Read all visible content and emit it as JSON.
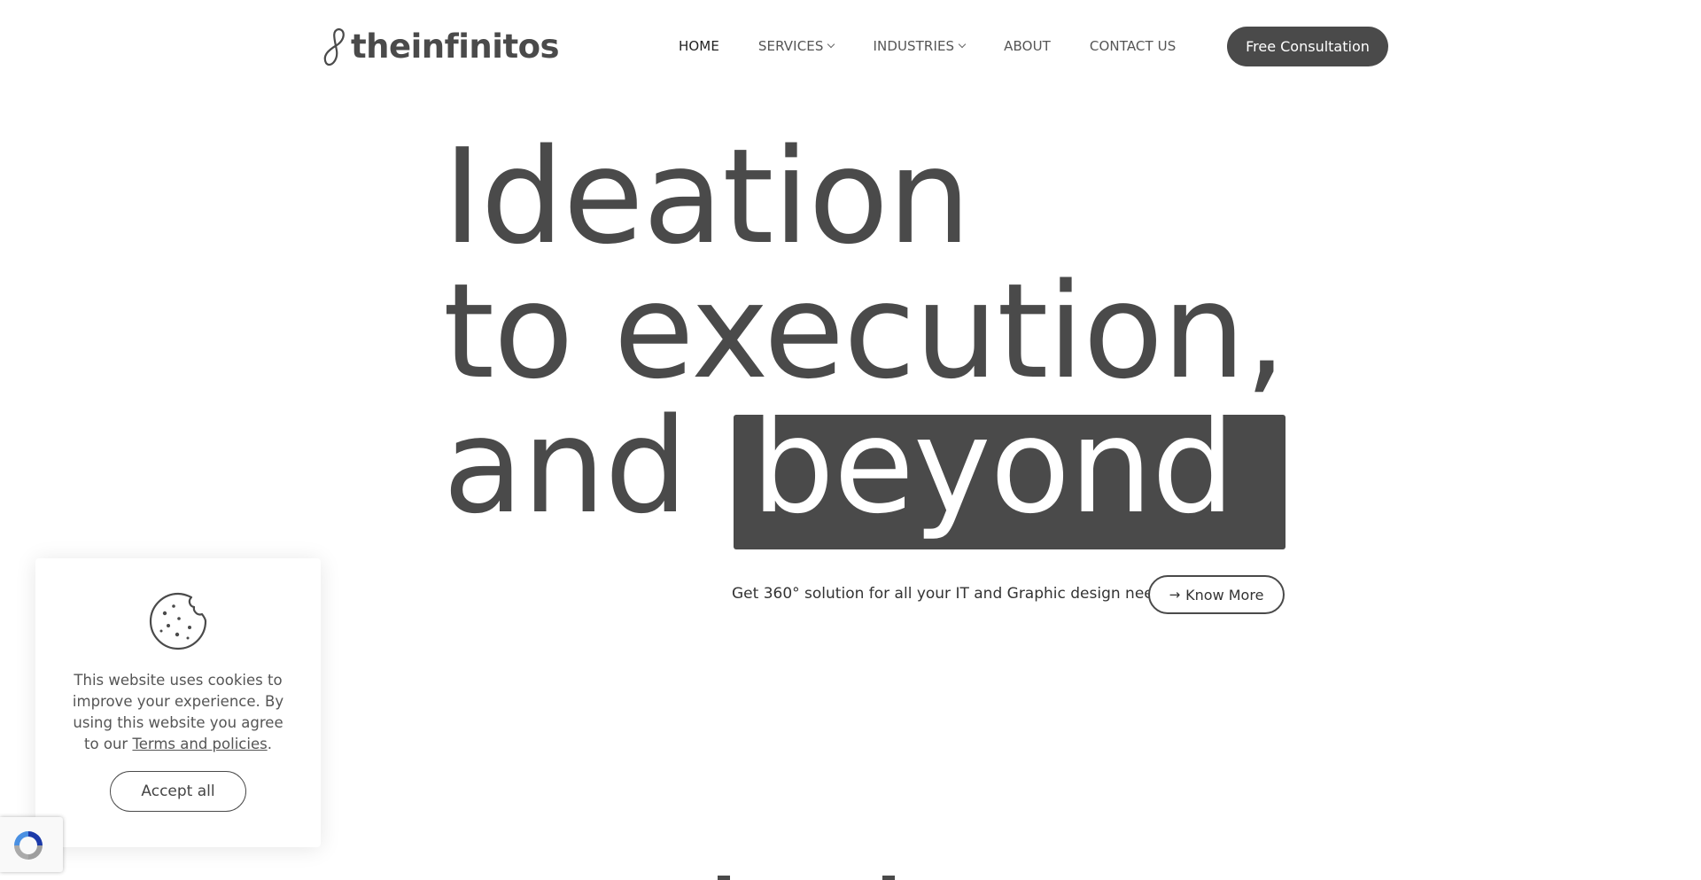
{
  "brand": {
    "logo_text": "theinfinitos"
  },
  "nav": {
    "items": [
      {
        "label": "HOME"
      },
      {
        "label": "SERVICES"
      },
      {
        "label": "INDUSTRIES"
      },
      {
        "label": "ABOUT"
      },
      {
        "label": "CONTACT US"
      }
    ],
    "cta_label": "Free Consultation"
  },
  "hero": {
    "line1": "Ideation",
    "line2": "to execution,",
    "line3_prefix": "and",
    "line3_highlight": "beyond",
    "tagline": "Get 360° solution for all your IT and Graphic design need",
    "know_more_label": "Know More"
  },
  "cookie": {
    "text_prefix": "This website uses cookies to improve your experience. By using this website you agree to our ",
    "link_text": "Terms and policies",
    "text_suffix": ".",
    "accept_label": "Accept all"
  },
  "icons": {
    "logo_mark": "infinity-loop-icon",
    "dropdown": "chevron-down-icon",
    "know_more_arrow": "arrow-right-icon",
    "cookie": "cookie-icon",
    "recaptcha": "recaptcha-icon"
  },
  "colors": {
    "primary": "#4a4a4a",
    "background": "#ffffff",
    "highlight_text": "#ffffff"
  }
}
